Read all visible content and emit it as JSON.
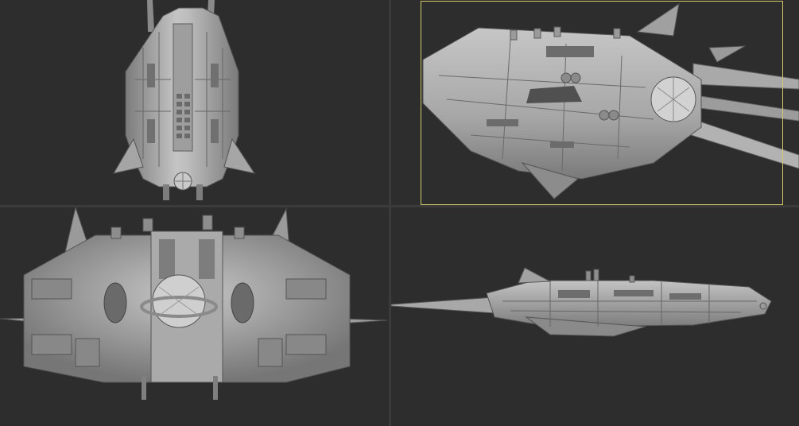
{
  "viewports": [
    {
      "id": "top",
      "model": "spaceship-top-view"
    },
    {
      "id": "perspective",
      "model": "spaceship-perspective-view",
      "active": true
    },
    {
      "id": "front",
      "model": "spaceship-front-view"
    },
    {
      "id": "side",
      "model": "spaceship-side-view"
    }
  ],
  "colors": {
    "background": "#2d2d2d",
    "divider": "#3b3b3b",
    "hull_light": "#b8b8b8",
    "hull_mid": "#8e8e8e",
    "hull_dark": "#5e5e5e",
    "camera_frame": "#cfc96a"
  }
}
